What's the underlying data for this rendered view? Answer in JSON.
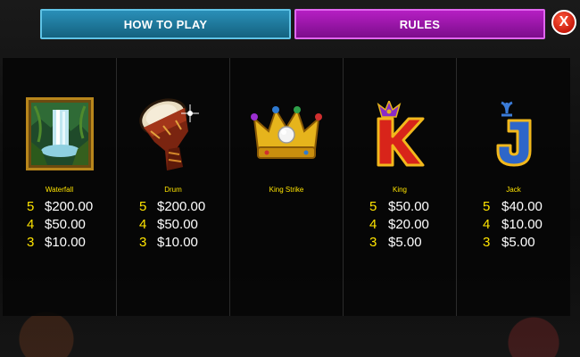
{
  "tabs": {
    "how_to_play": "HOW TO PLAY",
    "rules": "RULES"
  },
  "close_label": "X",
  "symbols": [
    {
      "name": "Waterfall",
      "icon": "waterfall-icon",
      "pays": [
        {
          "count": "5",
          "amount": "$200.00"
        },
        {
          "count": "4",
          "amount": "$50.00"
        },
        {
          "count": "3",
          "amount": "$10.00"
        }
      ]
    },
    {
      "name": "Drum",
      "icon": "drum-icon",
      "pays": [
        {
          "count": "5",
          "amount": "$200.00"
        },
        {
          "count": "4",
          "amount": "$50.00"
        },
        {
          "count": "3",
          "amount": "$10.00"
        }
      ]
    },
    {
      "name": "King Strike",
      "icon": "crown-icon",
      "pays": []
    },
    {
      "name": "King",
      "icon": "king-k-icon",
      "pays": [
        {
          "count": "5",
          "amount": "$50.00"
        },
        {
          "count": "4",
          "amount": "$20.00"
        },
        {
          "count": "3",
          "amount": "$5.00"
        }
      ]
    },
    {
      "name": "Jack",
      "icon": "jack-j-icon",
      "pays": [
        {
          "count": "5",
          "amount": "$40.00"
        },
        {
          "count": "4",
          "amount": "$10.00"
        },
        {
          "count": "3",
          "amount": "$5.00"
        }
      ]
    }
  ],
  "colors": {
    "tab_how_to_play": "#14627f",
    "tab_rules": "#7d0d8c",
    "close": "#c81a0c",
    "count_text": "#ffe400",
    "name_text": "#ffe400"
  }
}
